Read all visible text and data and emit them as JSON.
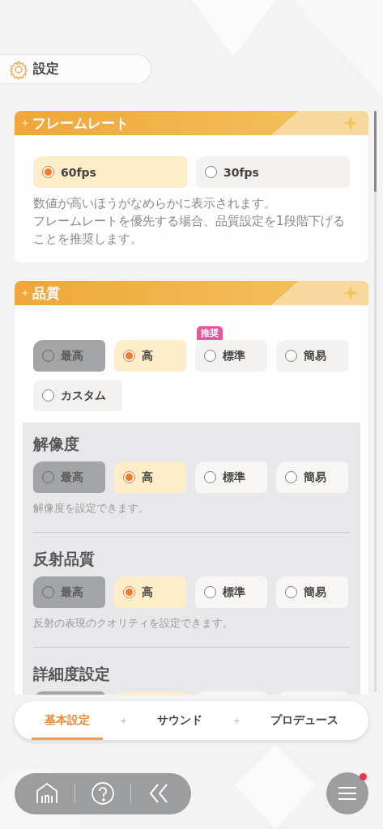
{
  "header": {
    "title": "設定"
  },
  "sections": [
    {
      "title": "フレームレート",
      "options": [
        {
          "label": "60fps",
          "selected": true,
          "disabled": false
        },
        {
          "label": "30fps",
          "selected": false,
          "disabled": false
        }
      ],
      "description": [
        "数値が高いほうがなめらかに表示されます。",
        "フレームレートを優先する場合、品質設定を1段階下げることを推奨します。"
      ]
    },
    {
      "title": "品質",
      "options": [
        {
          "label": "最高",
          "selected": false,
          "disabled": true
        },
        {
          "label": "高",
          "selected": true,
          "disabled": false
        },
        {
          "label": "標準",
          "selected": false,
          "disabled": false,
          "badge": "推奨"
        },
        {
          "label": "簡易",
          "selected": false,
          "disabled": false
        },
        {
          "label": "カスタム",
          "selected": false,
          "disabled": false
        }
      ],
      "subsettings": [
        {
          "title": "解像度",
          "options": [
            {
              "label": "最高",
              "selected": false,
              "disabled": true
            },
            {
              "label": "高",
              "selected": true,
              "disabled": false
            },
            {
              "label": "標準",
              "selected": false,
              "disabled": false
            },
            {
              "label": "簡易",
              "selected": false,
              "disabled": false
            }
          ],
          "description": "解像度を設定できます。"
        },
        {
          "title": "反射品質",
          "options": [
            {
              "label": "最高",
              "selected": false,
              "disabled": true
            },
            {
              "label": "高",
              "selected": true,
              "disabled": false
            },
            {
              "label": "標準",
              "selected": false,
              "disabled": false
            },
            {
              "label": "簡易",
              "selected": false,
              "disabled": false
            }
          ],
          "description": "反射の表現のクオリティを設定できます。"
        },
        {
          "title": "詳細度設定",
          "options": [
            {
              "selected": false,
              "disabled": true
            },
            {
              "selected": true,
              "disabled": false
            },
            {
              "selected": false,
              "disabled": false
            },
            {
              "selected": false,
              "disabled": false
            }
          ]
        }
      ]
    }
  ],
  "tabs": [
    {
      "label": "基本設定",
      "selected": true
    },
    {
      "label": "サウンド",
      "selected": false
    },
    {
      "label": "プロデュース",
      "selected": false
    }
  ],
  "menu": {
    "notification": true
  }
}
